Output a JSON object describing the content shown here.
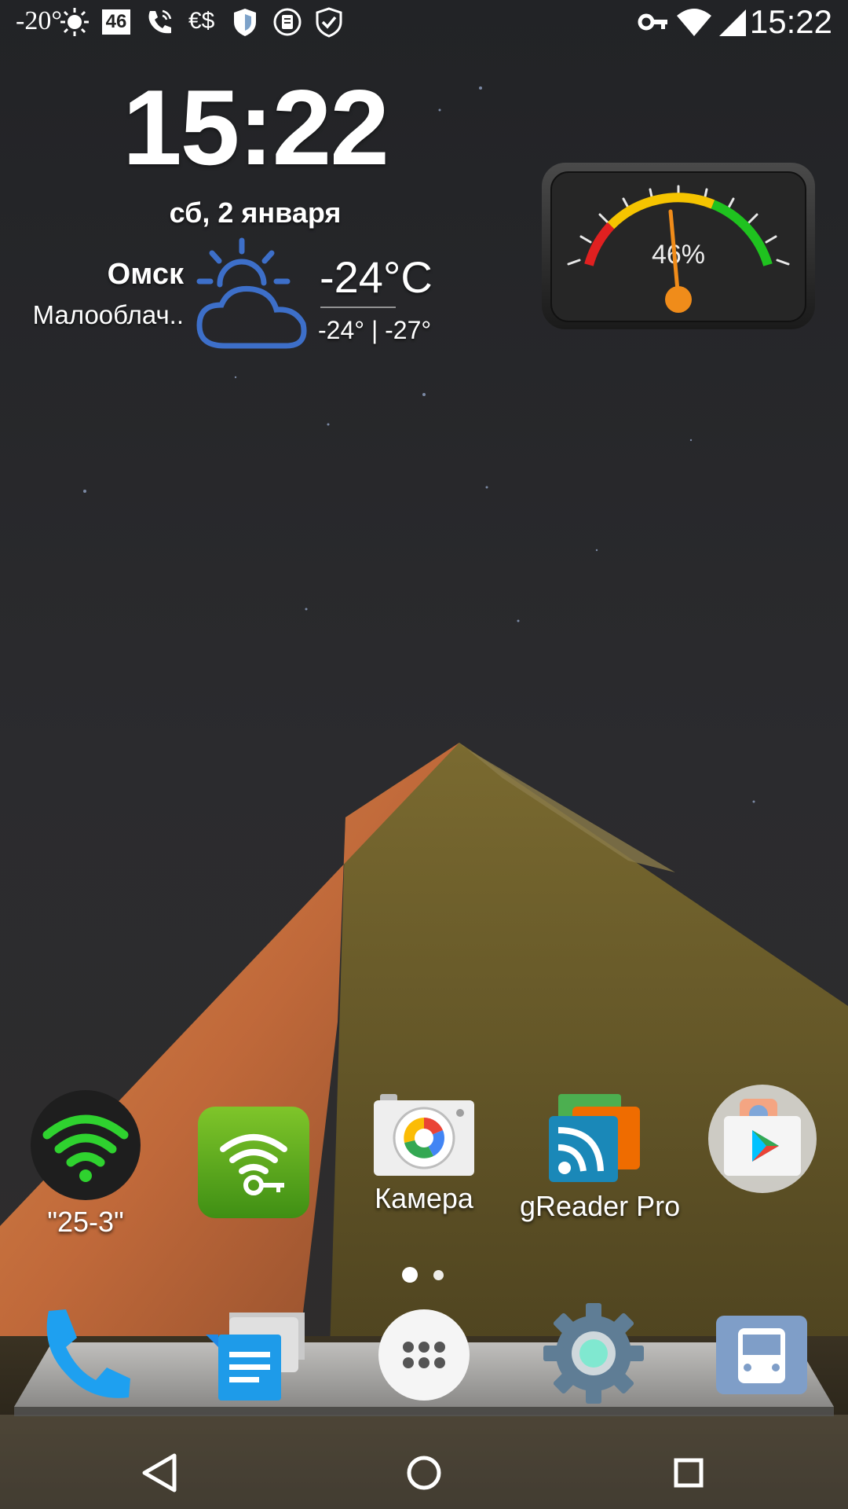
{
  "status_bar": {
    "temperature": "-20°",
    "network_badge": "46",
    "currency_icon_text": "€$",
    "time": "15:22",
    "icons": [
      "temperature-icon",
      "brightness-icon",
      "network-46-icon",
      "call-icon",
      "currency-icon",
      "shield-icon",
      "clipboard-icon",
      "shield-check-icon",
      "vpn-key-icon",
      "wifi-icon",
      "cell-signal-icon"
    ]
  },
  "clock_widget": {
    "time": "15:22",
    "date": "сб, 2 января",
    "city": "Омск",
    "condition": "Малооблач..",
    "temperature": "-24°C",
    "min_max": "-24° | -27°",
    "weather_icon": "partly-cloudy-icon"
  },
  "battery_gauge": {
    "label": "46%",
    "value_percent": 46
  },
  "home_apps": [
    {
      "name": "wifi-25-3-widget",
      "label": "\"25-3\"",
      "icon": "wifi-icon"
    },
    {
      "name": "wifi-key-app",
      "label": "",
      "icon": "wifi-key-icon"
    },
    {
      "name": "camera-app",
      "label": "Камера",
      "icon": "camera-icon"
    },
    {
      "name": "greader-app",
      "label": "gReader Pro",
      "icon": "rss-icon"
    },
    {
      "name": "play-store-folder",
      "label": "",
      "icon": "play-store-icon"
    }
  ],
  "page_indicator": {
    "pages": 2,
    "current": 1
  },
  "dock": [
    {
      "name": "phone",
      "icon": "phone-icon"
    },
    {
      "name": "messages",
      "icon": "messages-icon"
    },
    {
      "name": "app-drawer",
      "icon": "app-drawer-icon"
    },
    {
      "name": "settings",
      "icon": "settings-icon"
    },
    {
      "name": "bus-app",
      "icon": "bus-icon"
    }
  ],
  "nav_bar": [
    "back-icon",
    "home-icon",
    "recents-icon"
  ],
  "colors": {
    "sky": "#26272b",
    "pyramid_lit": "#c8703a",
    "pyramid_shadow": "#6e5a26",
    "weather_icon": "#3d6fc9",
    "gauge_needle": "#f08c1a",
    "wifi_green": "#2fd22f"
  }
}
